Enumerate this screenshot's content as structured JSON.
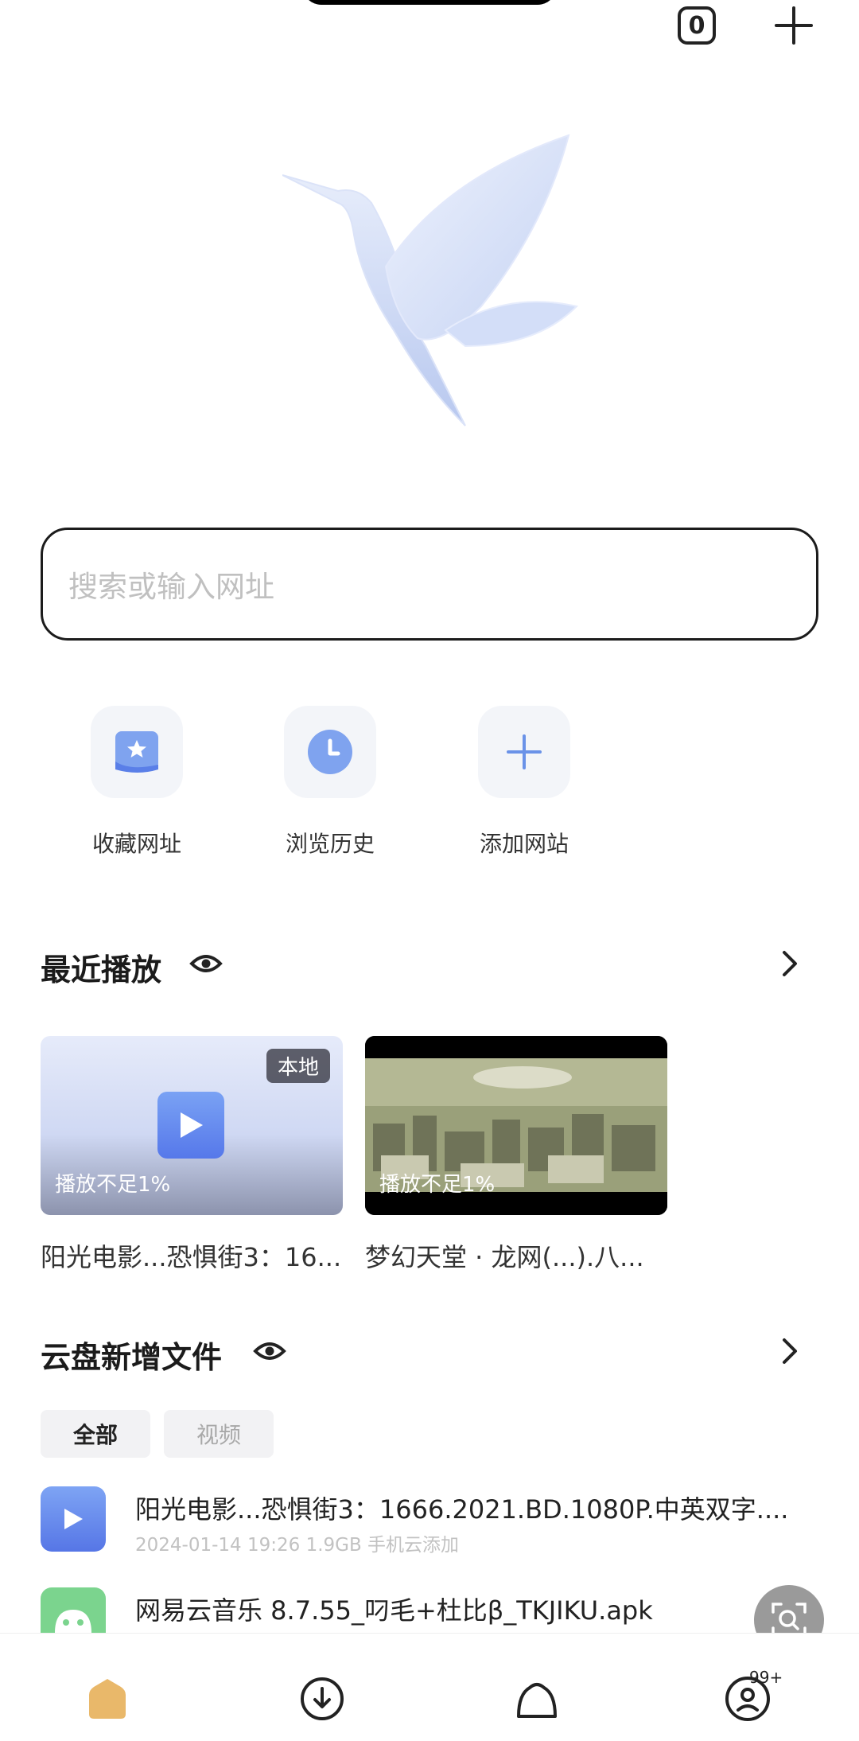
{
  "top_bar": {
    "tab_count": "0"
  },
  "search": {
    "placeholder": "搜索或输入网址"
  },
  "shortcuts": [
    {
      "label": "收藏网址",
      "icon": "bookmark-icon"
    },
    {
      "label": "浏览历史",
      "icon": "history-clock-icon"
    },
    {
      "label": "添加网站",
      "icon": "plus-icon"
    }
  ],
  "recent": {
    "title": "最近播放",
    "items": [
      {
        "badge": "本地",
        "progress": "播放不足1%",
        "title": "阳光电影...恐惧街3：16..."
      },
      {
        "progress": "播放不足1%",
        "title": "梦幻天堂 · 龙网(...).八..."
      }
    ]
  },
  "cloud": {
    "title": "云盘新增文件",
    "filters": [
      "全部",
      "视频"
    ],
    "active_filter": "全部",
    "files": [
      {
        "name": "阳光电影...恐惧街3：1666.2021.BD.1080P.中英双字....",
        "meta": "2024-01-14 19:26  1.9GB  手机云添加",
        "icon": "video-file-icon"
      },
      {
        "name": "网易云音乐 8.7.55_叼毛+杜比β_TKJIKU.apk",
        "meta": "",
        "icon": "android-apk-icon"
      }
    ]
  },
  "bottom_nav": {
    "profile_badge": "99+"
  },
  "colors": {
    "accent_blue": "#5a7fe8",
    "nav_home": "#e9b86a"
  }
}
